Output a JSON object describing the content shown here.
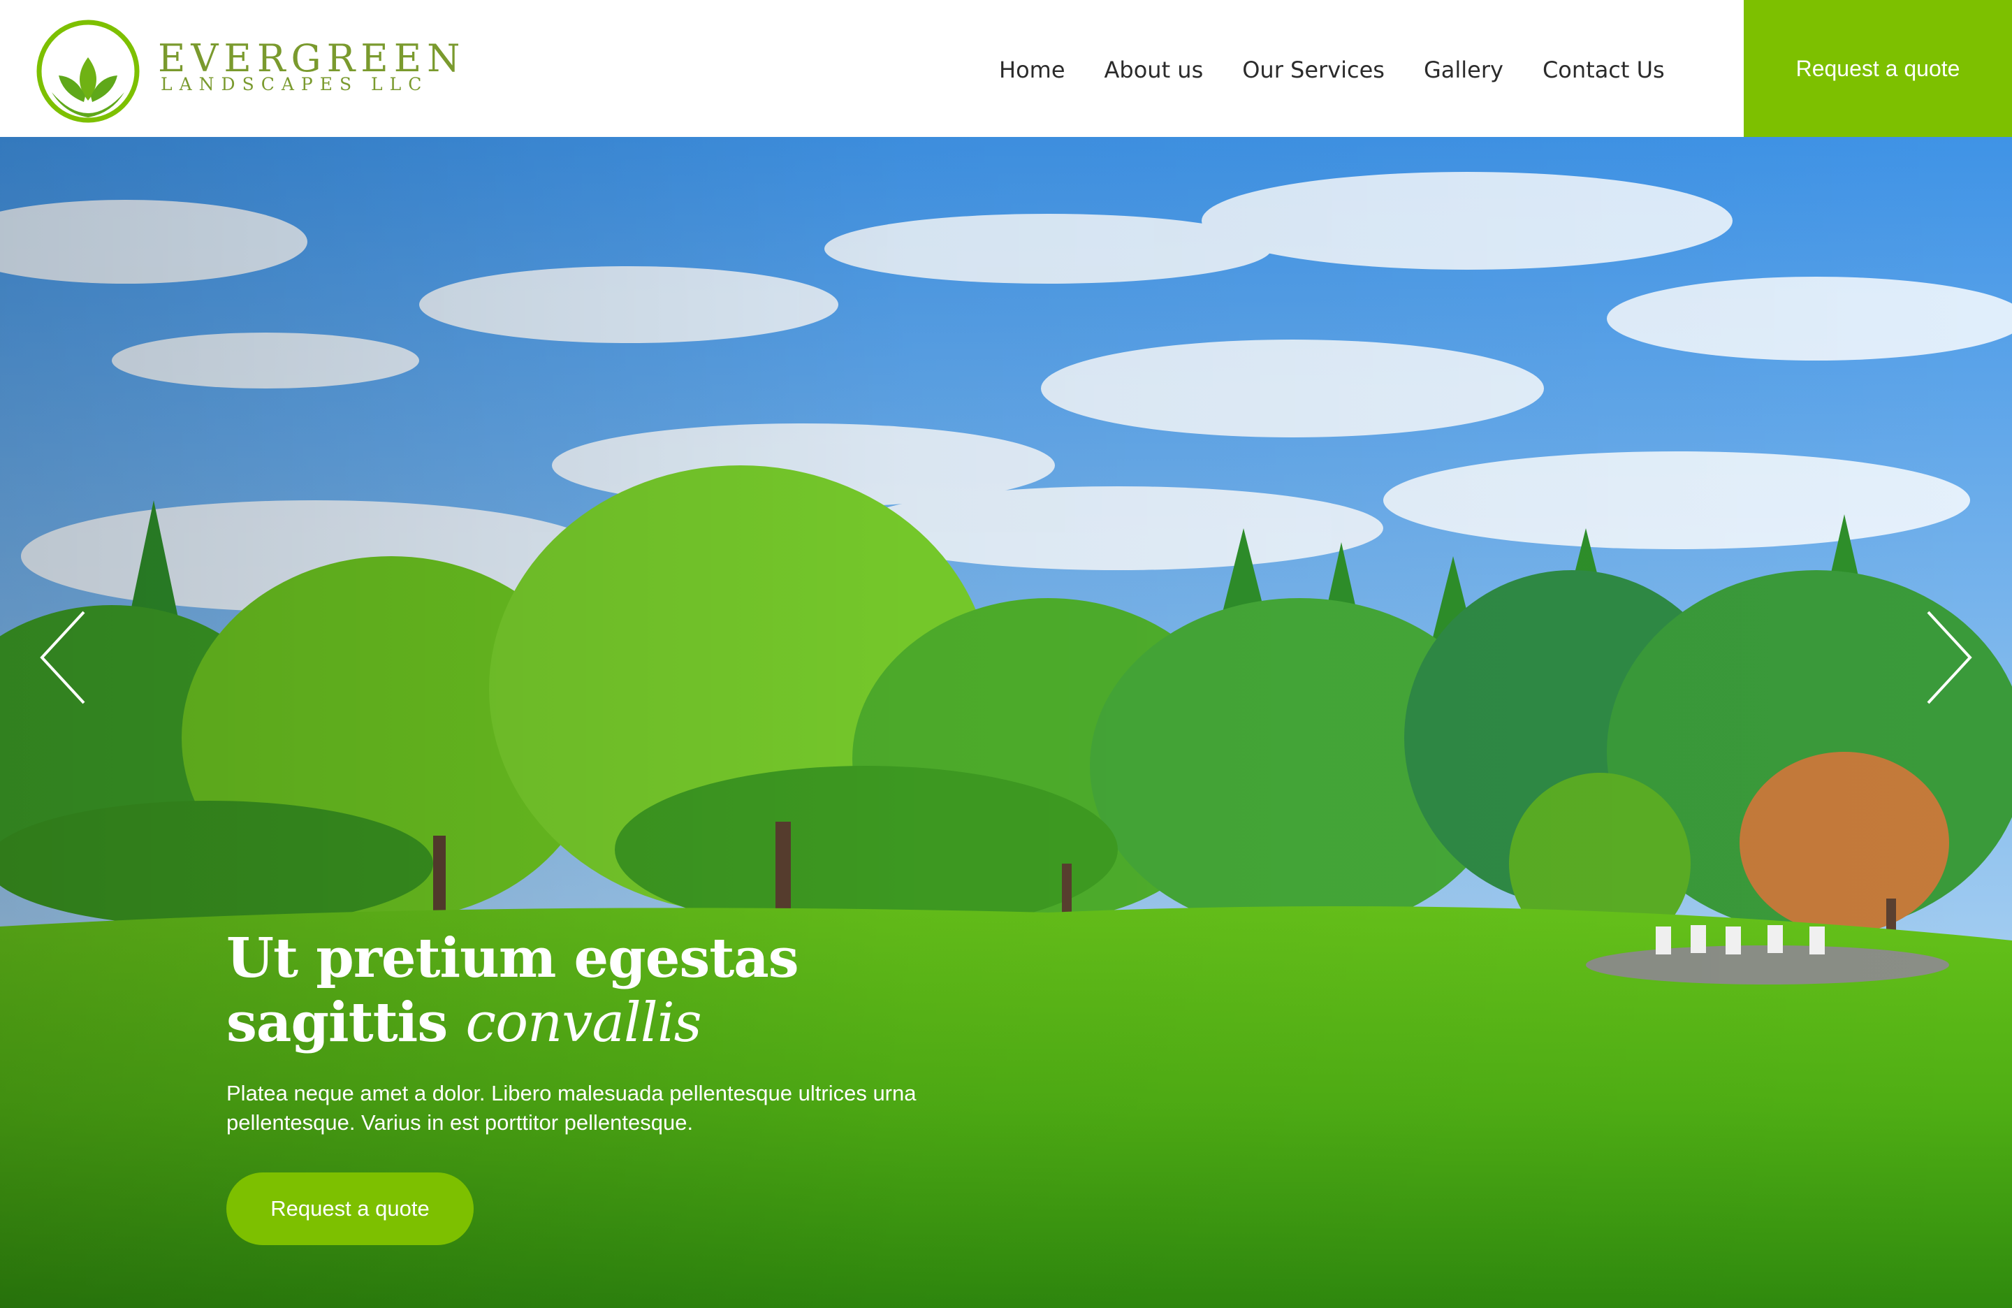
{
  "brand": {
    "name": "EVERGREEN",
    "subtitle": "LANDSCAPES LLC",
    "logo_icon": "leaf-circle-icon",
    "color": "#7a9a2e"
  },
  "nav": {
    "items": [
      {
        "label": "Home"
      },
      {
        "label": "About us"
      },
      {
        "label": "Our Services"
      },
      {
        "label": "Gallery"
      },
      {
        "label": "Contact Us"
      }
    ],
    "cta_label": "Request a quote"
  },
  "hero": {
    "title_line1": "Ut pretium egestas",
    "title_line2_plain": "sagittis ",
    "title_line2_italic": "convallis",
    "description": "Platea neque amet a dolor. Libero malesuada pellentesque ultrices urna pellentesque. Varius in est porttitor pellentesque.",
    "cta_label": "Request a quote",
    "prev_icon": "chevron-left-icon",
    "next_icon": "chevron-right-icon"
  },
  "colors": {
    "accent": "#7dc000",
    "nav_text": "#2b2b2b",
    "hero_text": "#ffffff"
  }
}
